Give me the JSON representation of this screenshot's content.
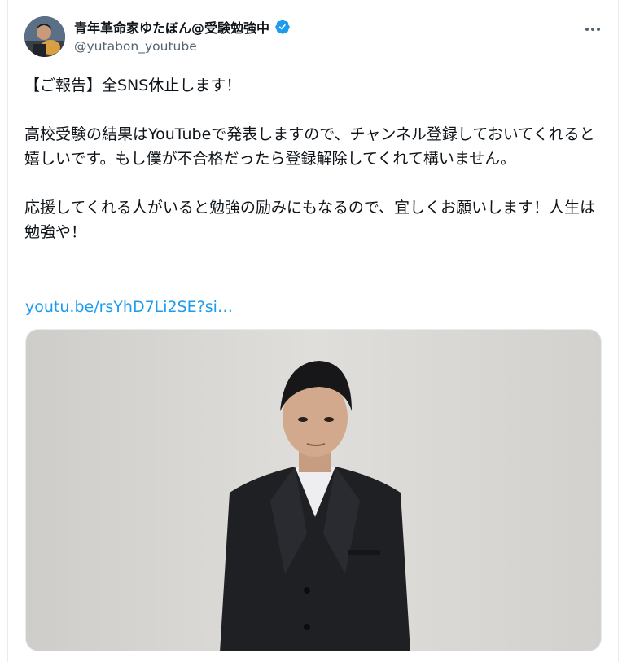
{
  "post": {
    "author": {
      "display_name": "青年革命家ゆたぼん@受験勉強中",
      "handle": "@yutabon_youtube",
      "verified": true
    },
    "paragraphs": [
      "【ご報告】全SNS休止します！",
      "高校受験の結果はYouTubeで発表しますので、チャンネル登録しておいてくれると嬉しいです。もし僕が不合格だったら登録解除してくれて構いません。",
      "応援してくれる人がいると勉強の励みにもなるので、宜しくお願いします！人生は勉強や！"
    ],
    "link_text": "youtu.be/rsYhD7Li2SE?si…",
    "icons": {
      "verified": "verified-badge-icon",
      "more": "more-options-icon"
    }
  },
  "colors": {
    "text": "#0f1419",
    "secondary": "#536471",
    "link": "#1d9bf0",
    "verified": "#1d9bf0"
  }
}
